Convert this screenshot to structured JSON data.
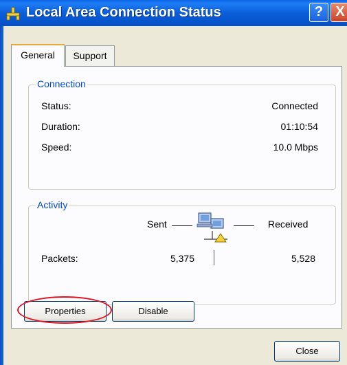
{
  "window": {
    "title": "Local Area Connection Status",
    "help_label": "?",
    "close_label": "X"
  },
  "tabs": [
    {
      "label": "General",
      "selected": true
    },
    {
      "label": "Support",
      "selected": false
    }
  ],
  "connection": {
    "group_label": "Connection",
    "status_label": "Status:",
    "status_value": "Connected",
    "duration_label": "Duration:",
    "duration_value": "01:10:54",
    "speed_label": "Speed:",
    "speed_value": "10.0 Mbps"
  },
  "activity": {
    "group_label": "Activity",
    "sent_label": "Sent",
    "received_label": "Received",
    "packets_label": "Packets:",
    "packets_sent": "5,375",
    "packets_received": "5,528"
  },
  "buttons": {
    "properties": "Properties",
    "disable": "Disable",
    "close": "Close"
  },
  "colors": {
    "titlebar": "#0a5fd9",
    "group_label": "#0046d5",
    "highlight": "#e0101c"
  }
}
